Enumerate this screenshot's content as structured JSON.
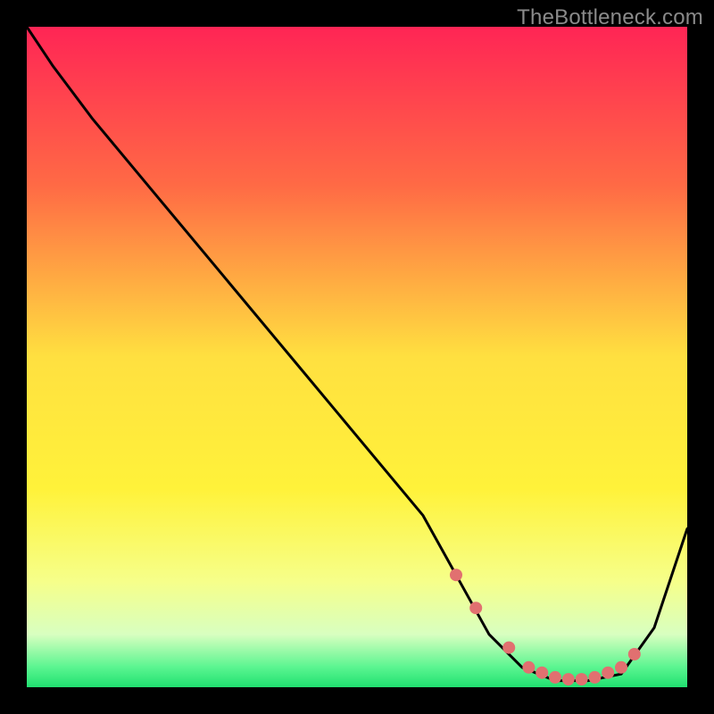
{
  "attribution": "TheBottleneck.com",
  "colors": {
    "frame": "#000000",
    "curve": "#000000",
    "dot": "#e17070",
    "gradient_top": "#ff2555",
    "gradient_mid_upper": "#ff8040",
    "gradient_mid": "#ffe040",
    "gradient_mid_lower": "#f7ff60",
    "gradient_pale": "#f0ffd0",
    "gradient_green": "#20e070"
  },
  "chart_data": {
    "type": "line",
    "title": "",
    "xlabel": "",
    "ylabel": "",
    "xlim": [
      0,
      100
    ],
    "ylim": [
      0,
      100
    ],
    "series": [
      {
        "name": "bottleneck-curve",
        "x": [
          0,
          4,
          10,
          20,
          30,
          40,
          50,
          60,
          65,
          70,
          75,
          80,
          85,
          90,
          95,
          100
        ],
        "y": [
          100,
          94,
          86,
          74,
          62,
          50,
          38,
          26,
          17,
          8,
          3,
          1,
          1,
          2,
          9,
          24
        ]
      }
    ],
    "markers": {
      "name": "sweet-spot-dots",
      "x": [
        65,
        68,
        73,
        76,
        78,
        80,
        82,
        84,
        86,
        88,
        90,
        92
      ],
      "y": [
        17,
        12,
        6,
        3,
        2.2,
        1.5,
        1.2,
        1.2,
        1.5,
        2.2,
        3.0,
        5.0
      ]
    }
  }
}
